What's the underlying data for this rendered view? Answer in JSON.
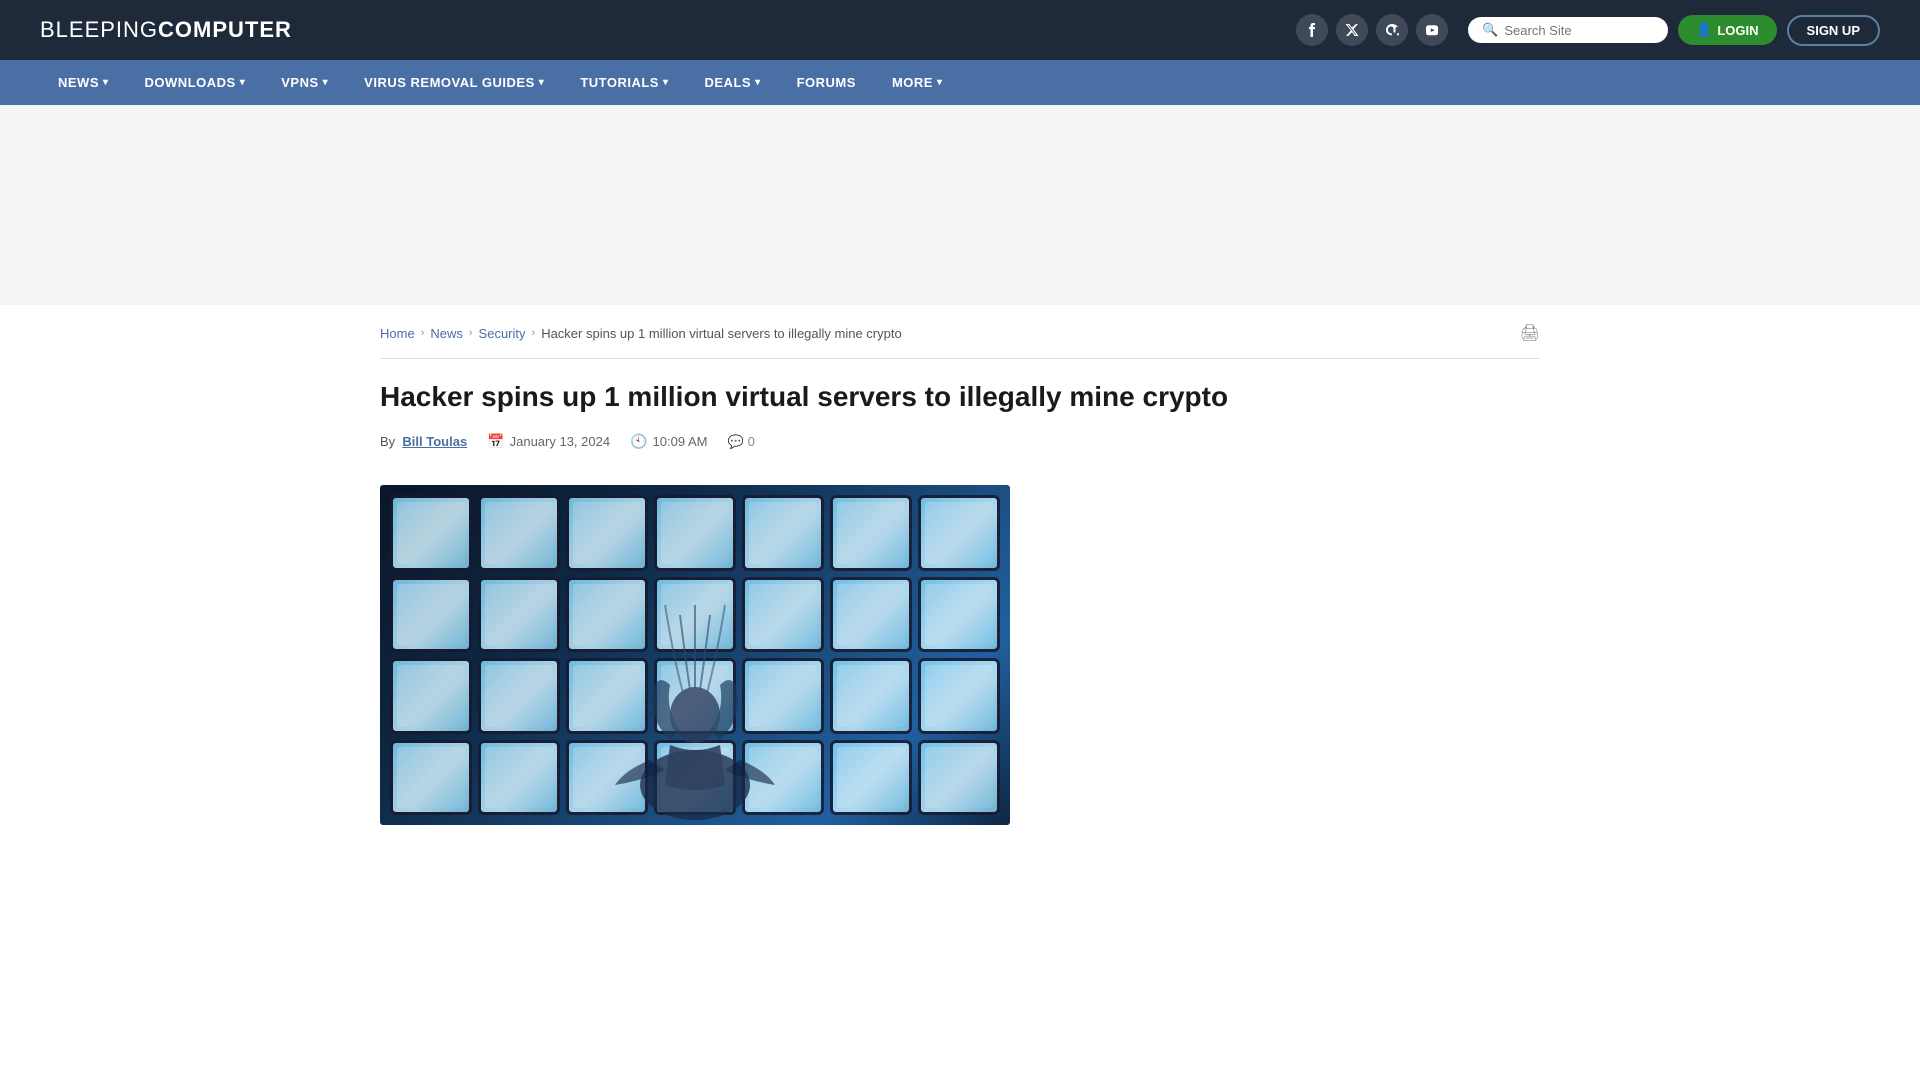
{
  "site": {
    "logo_text_light": "BLEEPING",
    "logo_text_bold": "COMPUTER"
  },
  "social": [
    {
      "name": "facebook",
      "icon": "f",
      "label": "Facebook"
    },
    {
      "name": "twitter",
      "icon": "𝕏",
      "label": "Twitter"
    },
    {
      "name": "mastodon",
      "icon": "m",
      "label": "Mastodon"
    },
    {
      "name": "youtube",
      "icon": "▶",
      "label": "YouTube"
    }
  ],
  "search": {
    "placeholder": "Search Site"
  },
  "buttons": {
    "login": "LOGIN",
    "signup": "SIGN UP"
  },
  "nav": [
    {
      "label": "NEWS",
      "has_dropdown": true
    },
    {
      "label": "DOWNLOADS",
      "has_dropdown": true
    },
    {
      "label": "VPNS",
      "has_dropdown": true
    },
    {
      "label": "VIRUS REMOVAL GUIDES",
      "has_dropdown": true
    },
    {
      "label": "TUTORIALS",
      "has_dropdown": true
    },
    {
      "label": "DEALS",
      "has_dropdown": true
    },
    {
      "label": "FORUMS",
      "has_dropdown": false
    },
    {
      "label": "MORE",
      "has_dropdown": true
    }
  ],
  "breadcrumb": {
    "home": "Home",
    "news": "News",
    "security": "Security",
    "current": "Hacker spins up 1 million virtual servers to illegally mine crypto"
  },
  "article": {
    "title": "Hacker spins up 1 million virtual servers to illegally mine crypto",
    "author_label": "By",
    "author_name": "Bill Toulas",
    "date": "January 13, 2024",
    "time": "10:09 AM",
    "comments": "0"
  }
}
